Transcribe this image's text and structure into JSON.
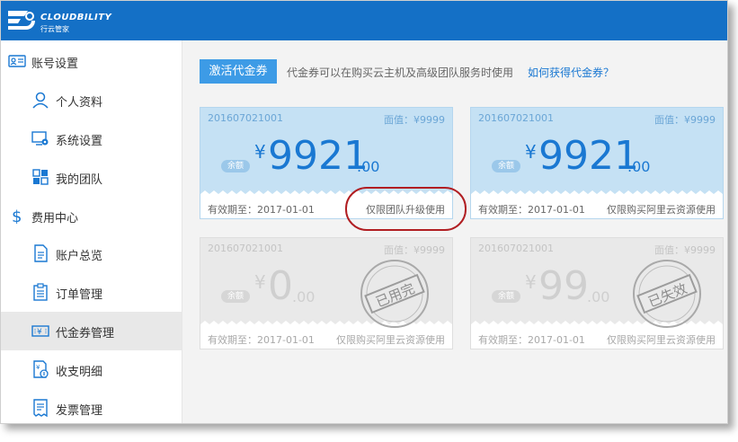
{
  "app": {
    "brand": "CLOUDBILITY",
    "subtitle": "行云管家"
  },
  "sidebar": {
    "account_group": "账号设置",
    "account_items": [
      {
        "label": "个人资料",
        "icon": "user-icon"
      },
      {
        "label": "系统设置",
        "icon": "settings-monitor-icon"
      },
      {
        "label": "我的团队",
        "icon": "team-grid-icon"
      }
    ],
    "billing_group": "费用中心",
    "billing_items": [
      {
        "label": "账户总览",
        "icon": "document-icon"
      },
      {
        "label": "订单管理",
        "icon": "clipboard-icon"
      },
      {
        "label": "代金券管理",
        "icon": "voucher-icon",
        "active": true
      },
      {
        "label": "收支明细",
        "icon": "income-expense-icon"
      },
      {
        "label": "发票管理",
        "icon": "invoice-icon"
      }
    ]
  },
  "main": {
    "activate_label": "激活代金券",
    "tip": "代金券可以在购买云主机及高级团队服务时使用",
    "help_link": "如何获得代金券？"
  },
  "vouchers": [
    {
      "code": "201607021001",
      "denomination": "面值：¥9999",
      "badge": "余额",
      "currency": "¥",
      "amount": "9921",
      "decimal": ".00",
      "expiry": "有效期至：2017-01-01",
      "scope": "仅限团队升级使用",
      "status": "valid"
    },
    {
      "code": "201607021001",
      "denomination": "面值：¥9999",
      "badge": "余额",
      "currency": "¥",
      "amount": "9921",
      "decimal": ".00",
      "expiry": "有效期至：2017-01-01",
      "scope": "仅限购买阿里云资源使用",
      "status": "valid"
    },
    {
      "code": "201607021001",
      "denomination": "面值：¥9999",
      "badge": "余额",
      "currency": "¥",
      "amount": "0",
      "decimal": ".00",
      "expiry": "有效期至：2017-01-01",
      "scope": "仅限购买阿里云资源使用",
      "status": "used",
      "stamp": "已用完"
    },
    {
      "code": "201607021001",
      "denomination": "面值：¥9999",
      "badge": "余额",
      "currency": "¥",
      "amount": "99",
      "decimal": ".00",
      "expiry": "有效期至：2017-01-01",
      "scope": "仅限购买阿里云资源使用",
      "status": "expired",
      "stamp": "已失效"
    }
  ],
  "colors": {
    "header": "#1470c6",
    "accent": "#3d9be6",
    "link": "#1a78d2",
    "annotation": "#b11e22"
  }
}
